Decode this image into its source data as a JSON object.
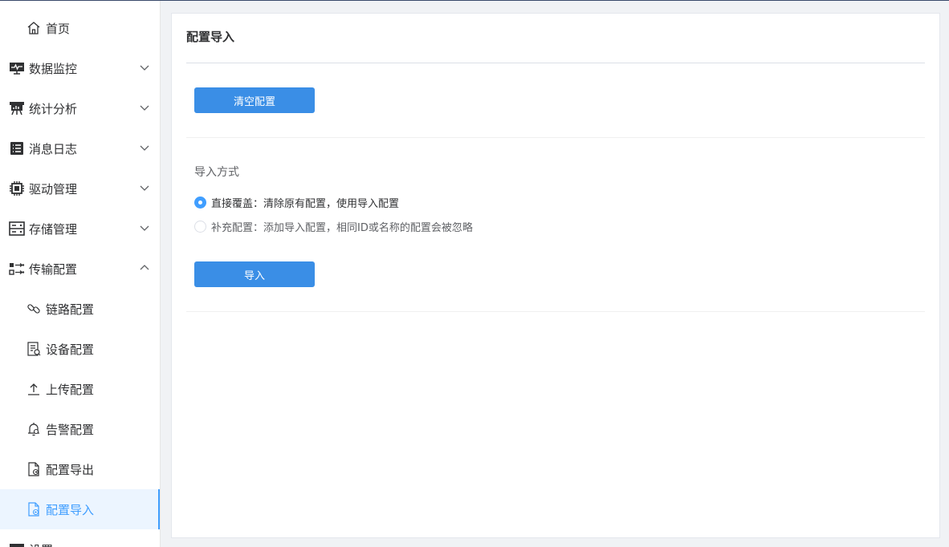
{
  "sidebar": {
    "items": [
      {
        "label": "首页",
        "icon": "home-icon"
      },
      {
        "label": "数据监控",
        "icon": "monitor-icon"
      },
      {
        "label": "统计分析",
        "icon": "chart-board-icon"
      },
      {
        "label": "消息日志",
        "icon": "log-icon"
      },
      {
        "label": "驱动管理",
        "icon": "chip-icon"
      },
      {
        "label": "存储管理",
        "icon": "storage-icon"
      },
      {
        "label": "传输配置",
        "icon": "transfer-icon"
      },
      {
        "label": "链路配置",
        "icon": "link-icon"
      },
      {
        "label": "设备配置",
        "icon": "device-icon"
      },
      {
        "label": "上传配置",
        "icon": "upload-icon"
      },
      {
        "label": "告警配置",
        "icon": "alarm-icon"
      },
      {
        "label": "配置导出",
        "icon": "export-file-icon"
      },
      {
        "label": "配置导入",
        "icon": "import-file-icon"
      },
      {
        "label": "设置",
        "icon": "settings-icon"
      }
    ]
  },
  "main": {
    "title": "配置导入",
    "clear_button": "清空配置",
    "import_mode_label": "导入方式",
    "options": [
      {
        "label": "直接覆盖：清除原有配置，使用导入配置",
        "selected": true
      },
      {
        "label": "补充配置：添加导入配置，相同ID或名称的配置会被忽略",
        "selected": false
      }
    ],
    "import_button": "导入"
  },
  "colors": {
    "accent": "#409eff",
    "button": "#3a8ee6"
  }
}
